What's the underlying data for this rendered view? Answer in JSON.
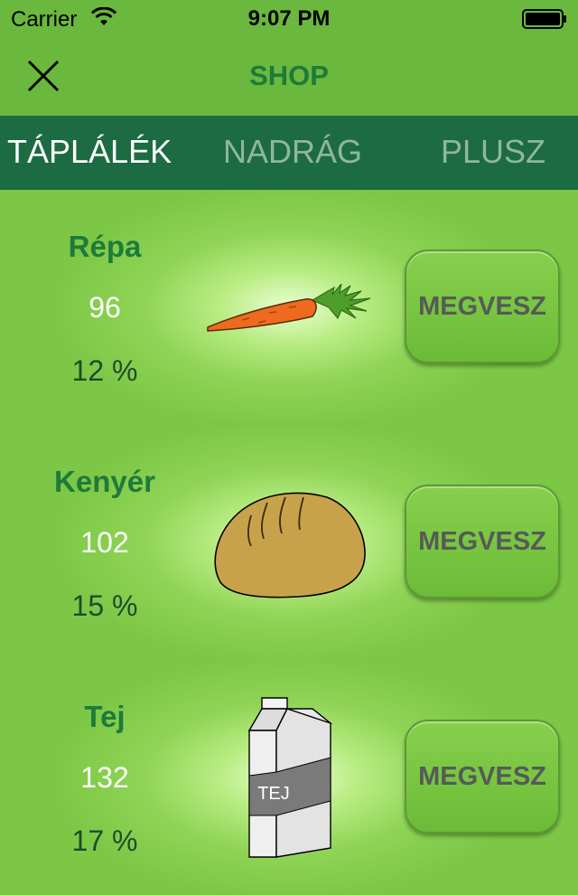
{
  "status_bar": {
    "carrier": "Carrier",
    "time": "9:07 PM",
    "icons": [
      "wifi-icon",
      "battery-icon"
    ]
  },
  "nav": {
    "title": "SHOP",
    "close_icon": "close-icon"
  },
  "tabs": [
    {
      "label": "TÁPLÁLÉK",
      "active": true
    },
    {
      "label": "NADRÁG",
      "active": false
    },
    {
      "label": "PLUSZ",
      "active": false
    }
  ],
  "items": [
    {
      "name": "Répa",
      "price": "96",
      "percent": "12 %",
      "button": "MEGVESZ",
      "icon": "carrot-icon"
    },
    {
      "name": "Kenyér",
      "price": "102",
      "percent": "15 %",
      "button": "MEGVESZ",
      "icon": "bread-icon"
    },
    {
      "name": "Tej",
      "price": "132",
      "percent": "17 %",
      "button": "MEGVESZ",
      "icon": "milk-carton-icon",
      "icon_label": "TEJ"
    }
  ],
  "colors": {
    "background": "#7dc746",
    "nav_background": "#6bb83f",
    "tab_background": "#1c6b43",
    "title_green": "#1e7a3a"
  }
}
